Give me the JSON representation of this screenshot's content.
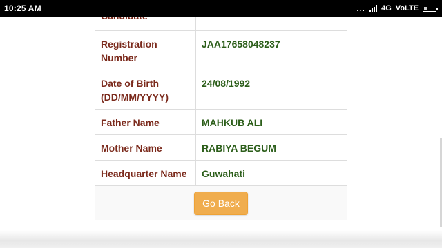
{
  "status_bar": {
    "time": "10:25 AM",
    "dots": "...",
    "network": "4G",
    "volte": "VoLTE"
  },
  "table": {
    "rows": [
      {
        "label": "Candidate",
        "value": ""
      },
      {
        "label": "Registration Number",
        "value": "JAA17658048237"
      },
      {
        "label": "Date of Birth (DD/MM/YYYY)",
        "value": "24/08/1992"
      },
      {
        "label": "Father Name",
        "value": "MAHKUB ALI"
      },
      {
        "label": "Mother Name",
        "value": "RABIYA BEGUM"
      },
      {
        "label": "Headquarter Name",
        "value": "Guwahati"
      }
    ]
  },
  "go_back_button": {
    "label": "Go Back"
  },
  "colors": {
    "label": "#7b2a1c",
    "value": "#2c5e1a",
    "button": "#f0ad4e"
  }
}
